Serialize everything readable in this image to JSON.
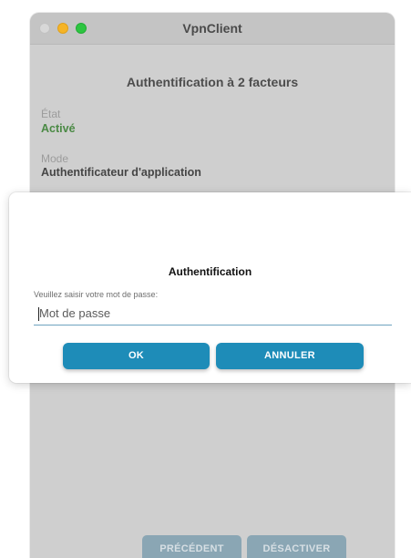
{
  "window": {
    "title": "VpnClient"
  },
  "page": {
    "title": "Authentification à 2 facteurs",
    "state": {
      "label": "État",
      "value": "Activé"
    },
    "mode": {
      "label": "Mode",
      "value": "Authentificateur d'application"
    },
    "buttons": {
      "previous": "PRÉCÉDENT",
      "deactivate": "DÉSACTIVER"
    }
  },
  "dialog": {
    "title": "Authentification",
    "prompt": "Veuillez saisir votre mot de passe:",
    "password_placeholder": "Mot de passe",
    "ok_label": "OK",
    "cancel_label": "ANNULER"
  },
  "colors": {
    "accent": "#1e8cb8",
    "state_active": "#4b8a45",
    "traffic_close": "#d8d8d8",
    "traffic_minimize": "#f5b427",
    "traffic_zoom": "#2dc541"
  }
}
